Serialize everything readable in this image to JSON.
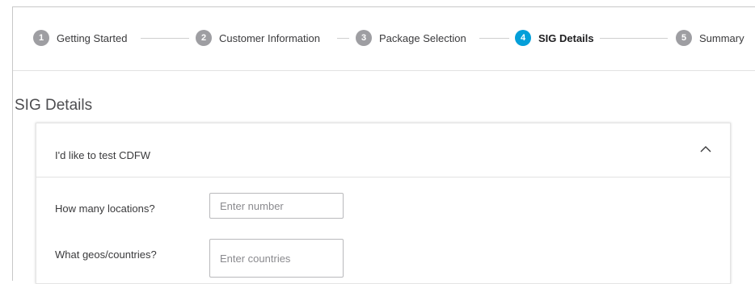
{
  "stepper": {
    "steps": [
      {
        "number": "1",
        "label": "Getting Started"
      },
      {
        "number": "2",
        "label": "Customer Information"
      },
      {
        "number": "3",
        "label": "Package Selection"
      },
      {
        "number": "4",
        "label": "SIG Details"
      },
      {
        "number": "5",
        "label": "Summary"
      }
    ],
    "active_step": 4,
    "active_color": "#049fd9",
    "inactive_color": "#9e9ea2"
  },
  "page": {
    "title": "SIG Details"
  },
  "card": {
    "title": "I'd like to test CDFW",
    "toggle_icon": "chevron-up-icon",
    "expanded": true,
    "fields": [
      {
        "label": "How many locations?",
        "value": "",
        "placeholder": "Enter number"
      },
      {
        "label": "What geos/countries?",
        "value": "",
        "placeholder": "Enter countries"
      }
    ]
  }
}
